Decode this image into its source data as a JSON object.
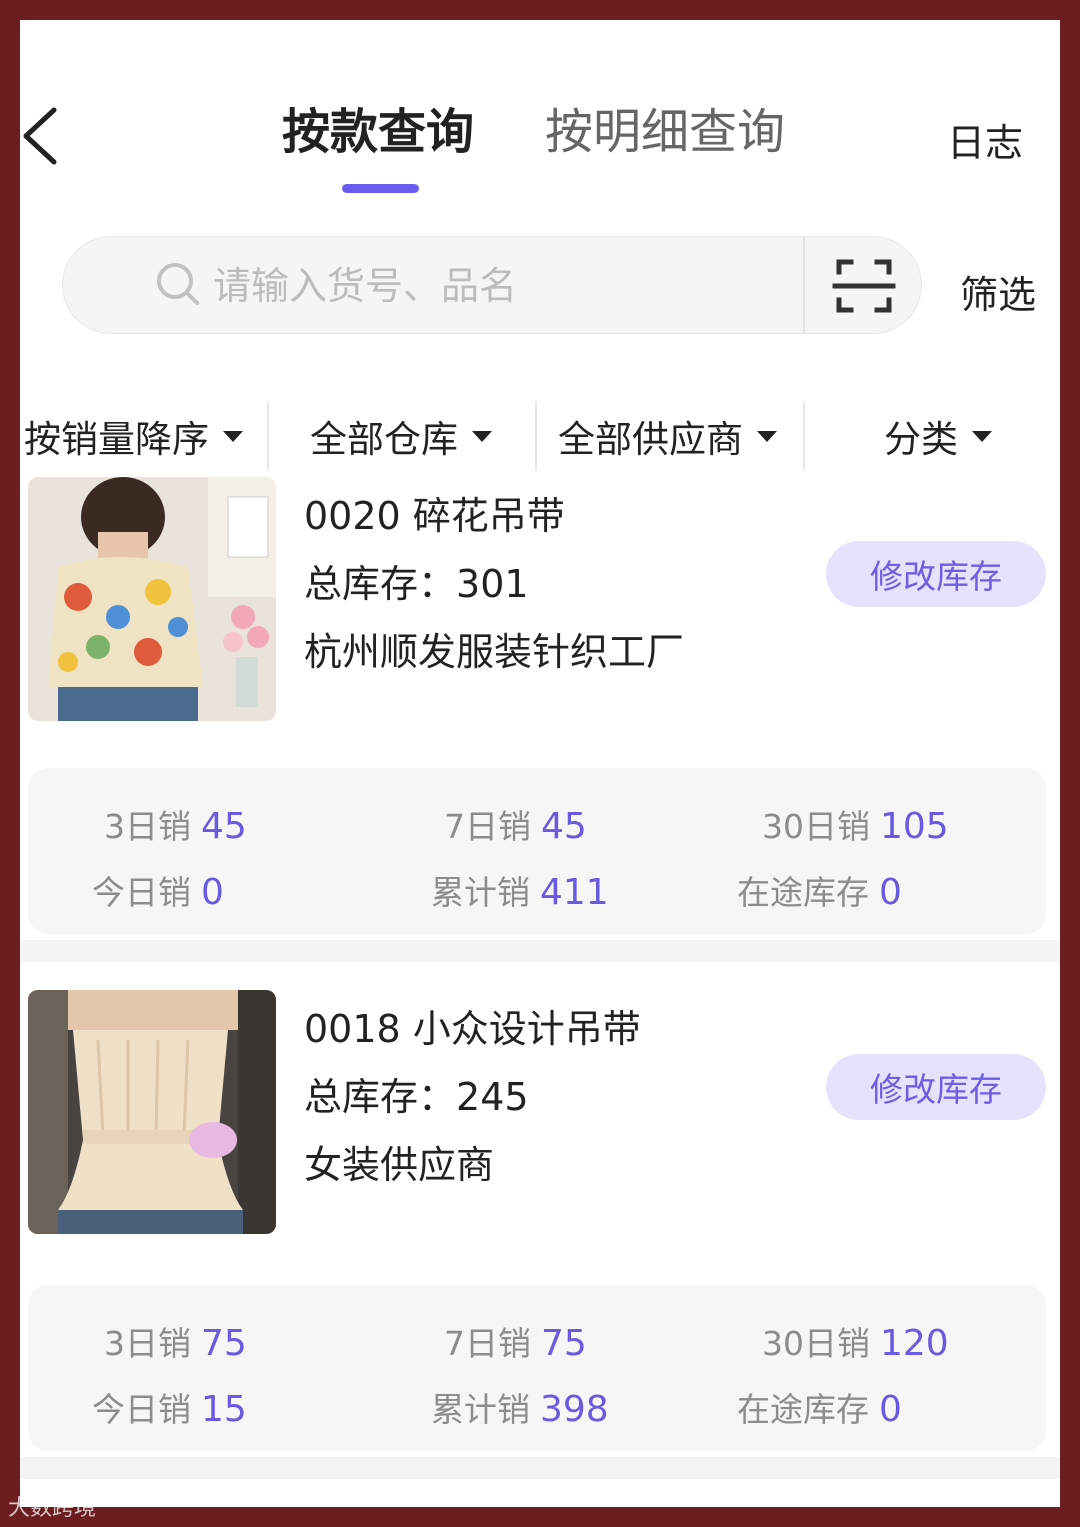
{
  "header": {
    "tabs": [
      {
        "label": "按款查询",
        "active": true
      },
      {
        "label": "按明细查询",
        "active": false
      }
    ],
    "log_label": "日志",
    "back_icon": "chevron-left-icon",
    "accent_color": "#6b5cf0"
  },
  "search": {
    "placeholder": "请输入货号、品名",
    "value": "",
    "scan_icon": "scan-icon",
    "filter_label": "筛选"
  },
  "sort_bar": {
    "items": [
      {
        "label": "按销量降序"
      },
      {
        "label": "全部仓库"
      },
      {
        "label": "全部供应商"
      },
      {
        "label": "分类"
      }
    ]
  },
  "products": [
    {
      "title": "0020 碎花吊带",
      "stock_label": "总库存：",
      "stock_value": "301",
      "supplier": "杭州顺发服装针织工厂",
      "edit_label": "修改库存",
      "stats": [
        {
          "label": "3日销",
          "value": "45"
        },
        {
          "label": "7日销",
          "value": "45"
        },
        {
          "label": "30日销",
          "value": "105"
        },
        {
          "label": "今日销",
          "value": "0"
        },
        {
          "label": "累计销",
          "value": "411"
        },
        {
          "label": "在途库存",
          "value": "0"
        }
      ]
    },
    {
      "title": "0018 小众设计吊带",
      "stock_label": "总库存：",
      "stock_value": "245",
      "supplier": "女装供应商",
      "edit_label": "修改库存",
      "stats": [
        {
          "label": "3日销",
          "value": "75"
        },
        {
          "label": "7日销",
          "value": "75"
        },
        {
          "label": "30日销",
          "value": "120"
        },
        {
          "label": "今日销",
          "value": "15"
        },
        {
          "label": "累计销",
          "value": "398"
        },
        {
          "label": "在途库存",
          "value": "0"
        }
      ]
    }
  ],
  "watermark": "大数跨境",
  "colors": {
    "frame": "#6b1d1f",
    "stat_number": "#6a5ae0",
    "edit_button_bg": "#e6e1fc",
    "edit_button_text": "#6e5de6"
  }
}
